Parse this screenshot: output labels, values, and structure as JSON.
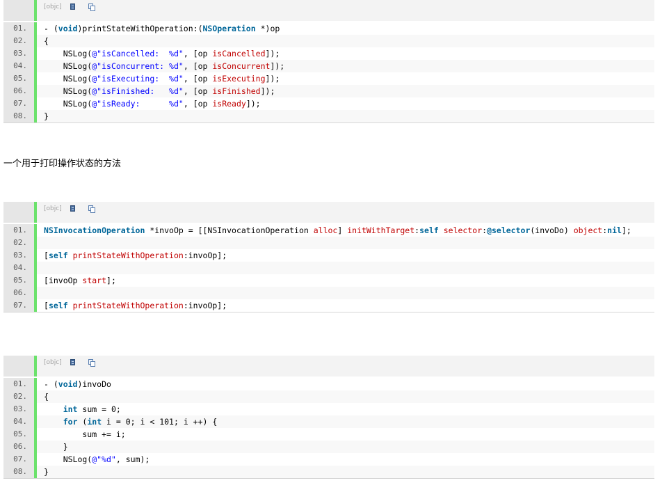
{
  "blocks": [
    {
      "lang": "[objc]",
      "lines": [
        {
          "num": "01.",
          "parts": [
            [
              "t",
              "- ("
            ],
            [
              "kw",
              "void"
            ],
            [
              "t",
              ")printStateWithOperation:("
            ],
            [
              "kw",
              "NSOperation"
            ],
            [
              "t",
              " *)op"
            ]
          ]
        },
        {
          "num": "02.",
          "parts": [
            [
              "t",
              "{"
            ]
          ]
        },
        {
          "num": "03.",
          "parts": [
            [
              "t",
              "    NSLog("
            ],
            [
              "str",
              "@\"isCancelled:  %d\""
            ],
            [
              "t",
              ", [op "
            ],
            [
              "sel",
              "isCancelled"
            ],
            [
              "t",
              "]);"
            ]
          ]
        },
        {
          "num": "04.",
          "parts": [
            [
              "t",
              "    NSLog("
            ],
            [
              "str",
              "@\"isConcurrent: %d\""
            ],
            [
              "t",
              ", [op "
            ],
            [
              "sel",
              "isConcurrent"
            ],
            [
              "t",
              "]);"
            ]
          ]
        },
        {
          "num": "05.",
          "parts": [
            [
              "t",
              "    NSLog("
            ],
            [
              "str",
              "@\"isExecuting:  %d\""
            ],
            [
              "t",
              ", [op "
            ],
            [
              "sel",
              "isExecuting"
            ],
            [
              "t",
              "]);"
            ]
          ]
        },
        {
          "num": "06.",
          "parts": [
            [
              "t",
              "    NSLog("
            ],
            [
              "str",
              "@\"isFinished:   %d\""
            ],
            [
              "t",
              ", [op "
            ],
            [
              "sel",
              "isFinished"
            ],
            [
              "t",
              "]);"
            ]
          ]
        },
        {
          "num": "07.",
          "parts": [
            [
              "t",
              "    NSLog("
            ],
            [
              "str",
              "@\"isReady:      %d\""
            ],
            [
              "t",
              ", [op "
            ],
            [
              "sel",
              "isReady"
            ],
            [
              "t",
              "]);"
            ]
          ]
        },
        {
          "num": "08.",
          "parts": [
            [
              "t",
              "}"
            ]
          ]
        }
      ]
    },
    {
      "lang": "[objc]",
      "lines": [
        {
          "num": "01.",
          "parts": [
            [
              "kw",
              "NSInvocationOperation"
            ],
            [
              "t",
              " *invoOp = [[NSInvocationOperation "
            ],
            [
              "sel",
              "alloc"
            ],
            [
              "t",
              "] "
            ],
            [
              "sel",
              "initWithTarget"
            ],
            [
              "t",
              ":"
            ],
            [
              "kw",
              "self"
            ],
            [
              "t",
              " "
            ],
            [
              "sel",
              "selector"
            ],
            [
              "t",
              ":"
            ],
            [
              "kw",
              "@selector"
            ],
            [
              "t",
              "(invoDo) "
            ],
            [
              "sel",
              "object"
            ],
            [
              "t",
              ":"
            ],
            [
              "kw",
              "nil"
            ],
            [
              "t",
              "];"
            ]
          ]
        },
        {
          "num": "02.",
          "parts": [
            [
              "t",
              ""
            ]
          ]
        },
        {
          "num": "03.",
          "parts": [
            [
              "t",
              "["
            ],
            [
              "kw",
              "self"
            ],
            [
              "t",
              " "
            ],
            [
              "sel",
              "printStateWithOperation"
            ],
            [
              "t",
              ":invoOp];"
            ]
          ]
        },
        {
          "num": "04.",
          "parts": [
            [
              "t",
              ""
            ]
          ]
        },
        {
          "num": "05.",
          "parts": [
            [
              "t",
              "[invoOp "
            ],
            [
              "sel",
              "start"
            ],
            [
              "t",
              "];"
            ]
          ]
        },
        {
          "num": "06.",
          "parts": [
            [
              "t",
              ""
            ]
          ]
        },
        {
          "num": "07.",
          "parts": [
            [
              "t",
              "["
            ],
            [
              "kw",
              "self"
            ],
            [
              "t",
              " "
            ],
            [
              "sel",
              "printStateWithOperation"
            ],
            [
              "t",
              ":invoOp];"
            ]
          ]
        }
      ]
    },
    {
      "lang": "[objc]",
      "lines": [
        {
          "num": "01.",
          "parts": [
            [
              "t",
              "- ("
            ],
            [
              "kw",
              "void"
            ],
            [
              "t",
              ")invoDo"
            ]
          ]
        },
        {
          "num": "02.",
          "parts": [
            [
              "t",
              "{"
            ]
          ]
        },
        {
          "num": "03.",
          "parts": [
            [
              "t",
              "    "
            ],
            [
              "kw",
              "int"
            ],
            [
              "t",
              " sum = 0;"
            ]
          ]
        },
        {
          "num": "04.",
          "parts": [
            [
              "t",
              "    "
            ],
            [
              "kw",
              "for"
            ],
            [
              "t",
              " ("
            ],
            [
              "kw",
              "int"
            ],
            [
              "t",
              " i = 0; i < 101; i ++) {"
            ]
          ]
        },
        {
          "num": "05.",
          "parts": [
            [
              "t",
              "        sum += i;"
            ]
          ]
        },
        {
          "num": "06.",
          "parts": [
            [
              "t",
              "    }"
            ]
          ]
        },
        {
          "num": "07.",
          "parts": [
            [
              "t",
              "    NSLog("
            ],
            [
              "str",
              "@\"%d\""
            ],
            [
              "t",
              ", sum);"
            ]
          ]
        },
        {
          "num": "08.",
          "parts": [
            [
              "t",
              "}"
            ]
          ]
        }
      ]
    }
  ],
  "caption": "一个用于打印操作状态的方法",
  "icons": {
    "view": "view-source-icon",
    "copy": "copy-icon"
  },
  "colors": {
    "gutter_bar": "#6ce26c",
    "keyword": "#006699",
    "string": "#0000ff",
    "selector": "#c00000"
  }
}
